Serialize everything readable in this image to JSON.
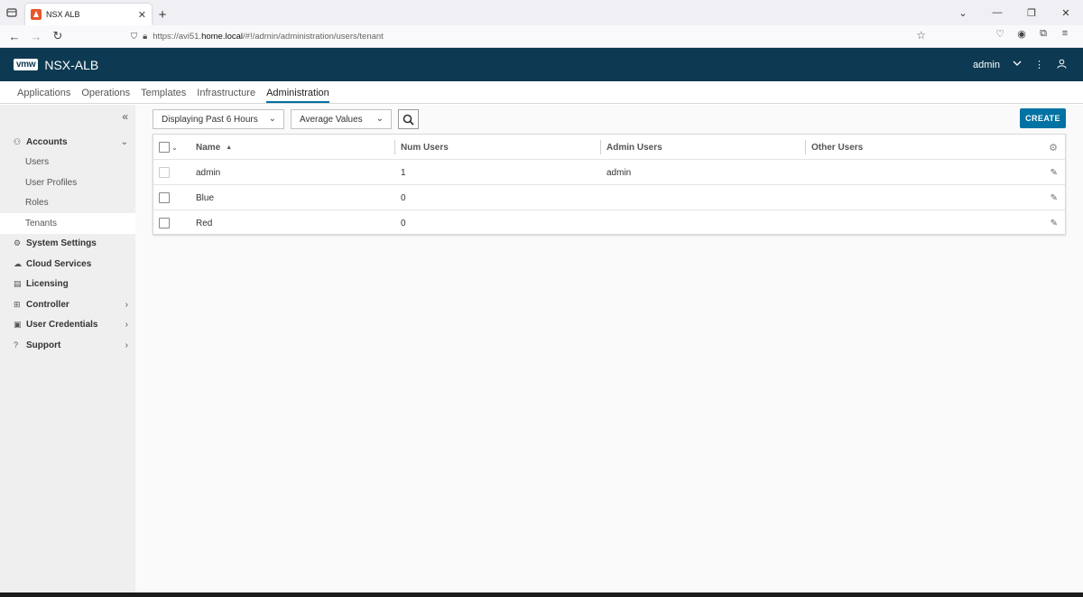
{
  "browser": {
    "tab_title": "NSX ALB",
    "url_prefix": "https://avi51.",
    "url_host": "home.local",
    "url_path": "/#!/admin/administration/users/tenant"
  },
  "app": {
    "brand": "vmw",
    "name": "NSX-ALB",
    "user": "admin"
  },
  "topnav": [
    "Applications",
    "Operations",
    "Templates",
    "Infrastructure",
    "Administration"
  ],
  "topnav_active": "Administration",
  "sidebar": {
    "accounts": "Accounts",
    "users": "Users",
    "user_profiles": "User Profiles",
    "roles": "Roles",
    "tenants": "Tenants",
    "system_settings": "System Settings",
    "cloud_services": "Cloud Services",
    "licensing": "Licensing",
    "controller": "Controller",
    "user_credentials": "User Credentials",
    "support": "Support"
  },
  "filters": {
    "time_range": "Displaying Past 6 Hours",
    "value_mode": "Average Values"
  },
  "create_label": "CREATE",
  "table": {
    "headers": {
      "name": "Name",
      "num_users": "Num Users",
      "admin_users": "Admin Users",
      "other_users": "Other Users"
    },
    "rows": [
      {
        "name": "admin",
        "num_users": "1",
        "admin_users": "admin",
        "other_users": ""
      },
      {
        "name": "Blue",
        "num_users": "0",
        "admin_users": "",
        "other_users": ""
      },
      {
        "name": "Red",
        "num_users": "0",
        "admin_users": "",
        "other_users": ""
      }
    ]
  },
  "colors": {
    "header_bg": "#0d3a52",
    "accent": "#0072a3",
    "sidebar_bg": "#efefef"
  }
}
